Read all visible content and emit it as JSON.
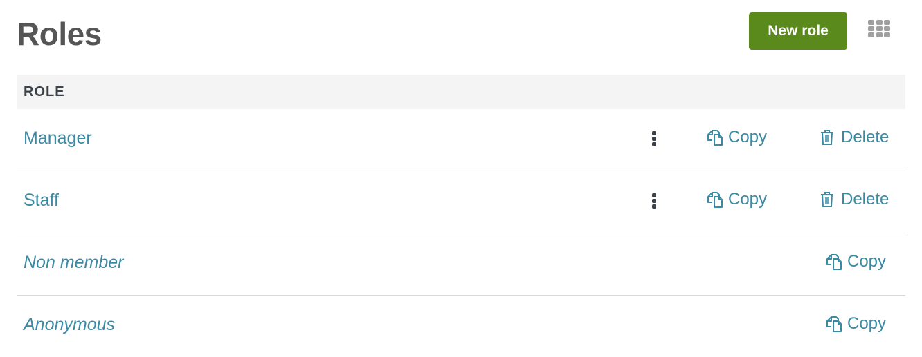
{
  "page": {
    "title": "Roles",
    "new_button_label": "New role",
    "apps_icon": "grid-icon"
  },
  "table": {
    "header": "ROLE",
    "rows": [
      {
        "name": "Manager",
        "italic": false,
        "has_menu": true,
        "actions": [
          "Copy",
          "Delete"
        ]
      },
      {
        "name": "Staff",
        "italic": false,
        "has_menu": true,
        "actions": [
          "Copy",
          "Delete"
        ]
      },
      {
        "name": "Non member",
        "italic": true,
        "has_menu": false,
        "actions": [
          "Copy"
        ]
      },
      {
        "name": "Anonymous",
        "italic": true,
        "has_menu": false,
        "actions": [
          "Copy"
        ]
      }
    ],
    "copy_label": "Copy",
    "delete_label": "Delete"
  },
  "colors": {
    "primary_button": "#5a8a1c",
    "link": "#3b8aa3",
    "title": "#555555",
    "header_bg": "#f4f4f4"
  }
}
